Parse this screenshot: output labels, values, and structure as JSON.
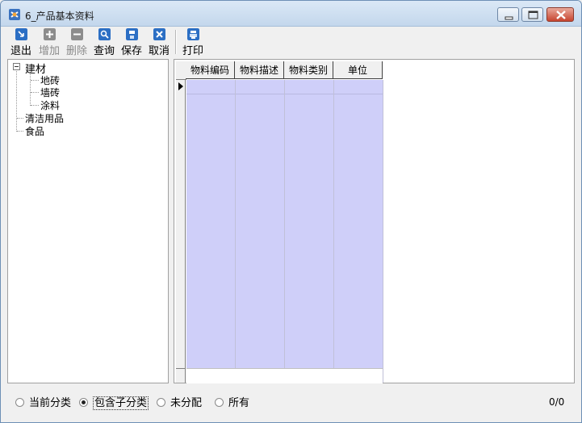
{
  "window": {
    "title": "6_产品基本资料",
    "controls": {
      "minimize_icon": "window-minimize-icon",
      "maximize_icon": "window-maximize-icon",
      "close_icon": "window-close-icon"
    }
  },
  "toolbar": {
    "buttons": [
      {
        "label": "退出",
        "icon": "exit-icon",
        "enabled": true,
        "color": "#2c6fc4"
      },
      {
        "label": "增加",
        "icon": "plus-icon",
        "enabled": false,
        "color": "#8c8c8c"
      },
      {
        "label": "删除",
        "icon": "minus-icon",
        "enabled": false,
        "color": "#8c8c8c"
      },
      {
        "label": "查询",
        "icon": "search-icon",
        "enabled": true,
        "color": "#2c6fc4"
      },
      {
        "label": "保存",
        "icon": "save-icon",
        "enabled": true,
        "color": "#2c6fc4"
      },
      {
        "label": "取消",
        "icon": "cancel-icon",
        "enabled": true,
        "color": "#2c6fc4"
      },
      {
        "label": "打印",
        "icon": "print-icon",
        "enabled": true,
        "color": "#2c6fc4"
      }
    ]
  },
  "tree": {
    "nodes": [
      {
        "label": "建材",
        "expanded": true,
        "children": [
          {
            "label": "地砖"
          },
          {
            "label": "墙砖"
          },
          {
            "label": "涂料"
          }
        ]
      },
      {
        "label": "清洁用品"
      },
      {
        "label": "食品"
      }
    ]
  },
  "grid": {
    "columns": [
      "物料编码",
      "物料描述",
      "物料类别",
      "单位"
    ],
    "rows": [],
    "selection_color": "#cfcff9"
  },
  "filters": {
    "options": [
      "当前分类",
      "包含子分类",
      "未分配",
      "所有"
    ],
    "selected": "包含子分类"
  },
  "status": {
    "record_count": "0/0"
  }
}
